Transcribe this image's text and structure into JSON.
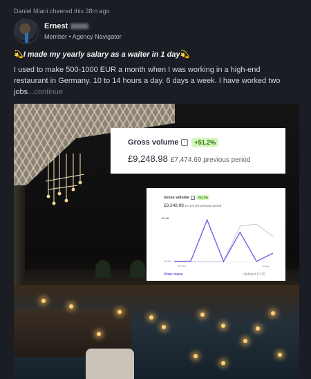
{
  "activity": {
    "cheer_text": "Daniel Miani cheered this 38m ago"
  },
  "author": {
    "name": "Ernest",
    "role": "Member • Agency Navigator"
  },
  "post": {
    "title_emoji": "💫",
    "title": "I made my yearly salary as a waiter in 1 day",
    "body": "I used to make 500-1000 EUR a month when I was working in a high-end restaurant in Germany. 10 to 14 hours a day. 6 days a week. I have worked two jobs",
    "more_label": "...continue"
  },
  "stats_card": {
    "title": "Gross volume",
    "info_glyph": "i",
    "change": "+51.2%",
    "amount": "£9,248.98",
    "previous": "£7,474.69 previous period"
  },
  "mini_card": {
    "title": "Gross volume",
    "change": "+51.2%",
    "amount": "£9,248.98",
    "previous": "£7,474.69 previous period",
    "y_max_label": "£9.98",
    "y_min_label": "£0.00",
    "x_start_label": "30 Nov",
    "x_end_label": "Today",
    "view_more": "View more",
    "updated": "Updated 10:26"
  },
  "chart_data": {
    "type": "line",
    "x": [
      "30 Nov",
      "",
      "",
      "",
      "",
      "",
      "Today"
    ],
    "series": [
      {
        "values": [
          0,
          0,
          9.98,
          0,
          7.0,
          0,
          2.0
        ]
      },
      {
        "values": [
          0,
          0,
          0,
          0,
          8.5,
          9.0,
          6.0
        ]
      }
    ],
    "ylim": [
      0,
      9.98
    ],
    "colors": {
      "current": "#6b63e6",
      "previous": "#c9cbd4"
    }
  },
  "colors": {
    "accent_pill_bg": "#d7f7c2",
    "accent_pill_text": "#217005",
    "link": "#5a56d6"
  }
}
